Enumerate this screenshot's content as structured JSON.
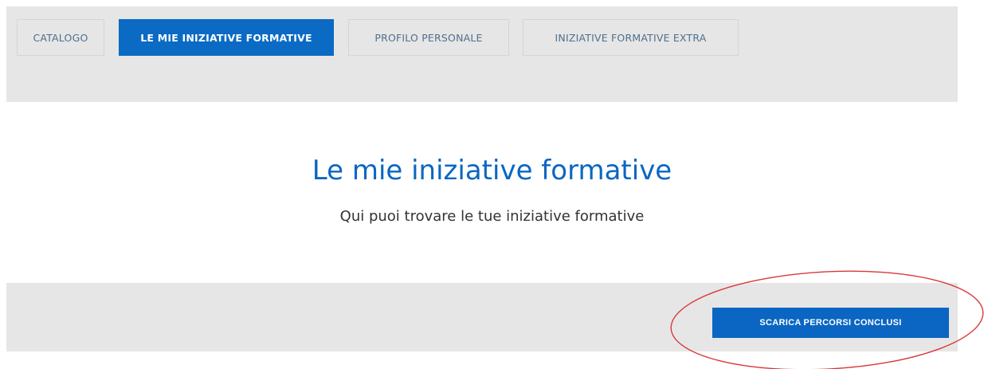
{
  "nav": {
    "tabs": [
      {
        "label": "CATALOGO",
        "active": false
      },
      {
        "label": "LE MIE INIZIATIVE FORMATIVE",
        "active": true
      },
      {
        "label": "PROFILO PERSONALE",
        "active": false
      },
      {
        "label": "INIZIATIVE FORMATIVE EXTRA",
        "active": false
      }
    ]
  },
  "main": {
    "title": "Le mie iniziative formative",
    "subtitle": "Qui puoi trovare le tue iniziative formative"
  },
  "actions": {
    "download_label": "SCARICA PERCORSI CONCLUSI"
  },
  "colors": {
    "accent": "#0a66c2",
    "bar_background": "#e6e6e6",
    "annotation": "#d9383a"
  }
}
